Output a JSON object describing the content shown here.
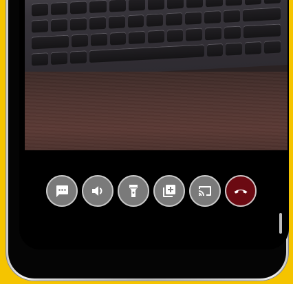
{
  "call_controls": {
    "buttons": [
      {
        "icon": "chat-icon"
      },
      {
        "icon": "speaker-icon"
      },
      {
        "icon": "flashlight-icon"
      },
      {
        "icon": "add-to-library-icon"
      },
      {
        "icon": "cast-icon"
      },
      {
        "icon": "end-call-icon"
      }
    ]
  },
  "colors": {
    "background_accent": "#f5c400",
    "control_button": "#7a7a7a",
    "end_call_button": "#6b0a12"
  }
}
